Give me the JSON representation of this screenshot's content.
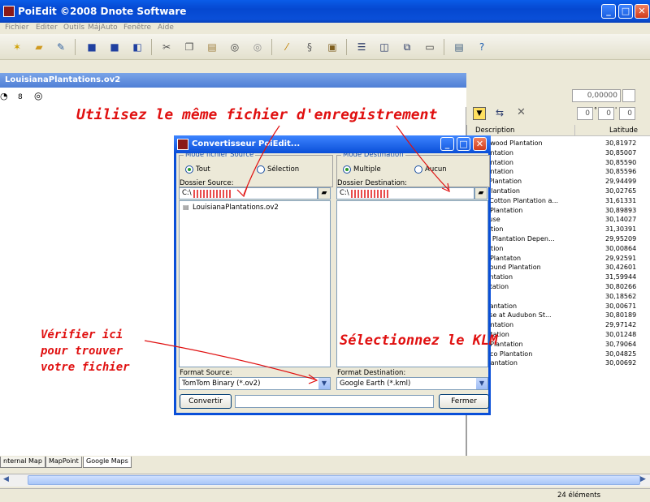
{
  "app": {
    "title": "PoiEdit ©2008 Dnote Software",
    "minimize": "_",
    "maximize": "□",
    "close": "✕"
  },
  "menu": [
    "Fichier",
    "Editer",
    "Outils",
    "MájAuto",
    "Fenêtre",
    "Aide"
  ],
  "document": {
    "tab": "LouisianaPlantations.ov2",
    "zoom_value": "8"
  },
  "right_panel": {
    "coord_field": "0,00000",
    "dms_1": "0",
    "dms_2": "0",
    "dms_3": "0",
    "col_desc": "Description",
    "col_lat": "Latitude",
    "rows": [
      {
        "d": "Greenwood Plantation",
        "l": "30,81972"
      },
      {
        "d": "ge Plantation",
        "l": "30,85007"
      },
      {
        "d": "ge Plantation",
        "l": "30,85590"
      },
      {
        "d": "ge Plantation",
        "l": "30,85596"
      },
      {
        "d": "phan Plantation",
        "l": "29,94499"
      },
      {
        "d": "reen Plantation",
        "l": "30,02765"
      },
      {
        "d": "more Cotton Plantation a...",
        "l": "31,61331"
      },
      {
        "d": "wood Plantation",
        "l": "30,89893"
      },
      {
        "d": "as House",
        "l": "30,14027"
      },
      {
        "d": "Plantation",
        "l": "31,30391"
      },
      {
        "d": "anche Plantation Depen...",
        "l": "29,95209"
      },
      {
        "d": "Plantation",
        "l": "30,00864"
      },
      {
        "d": "wood Plantaton",
        "l": "29,92591"
      },
      {
        "d": "olia Mound Plantation",
        "l": "30,42601"
      },
      {
        "d": "se Plantation",
        "l": "31,59944"
      },
      {
        "d": "s Plantation",
        "l": "30,80266"
      },
      {
        "d": "way",
        "l": "30,18562"
      },
      {
        "d": "lley Plantation",
        "l": "30,00671"
      },
      {
        "d": "y House at Audubon St...",
        "l": "30,80189"
      },
      {
        "d": "nd Plantation",
        "l": "29,97142"
      },
      {
        "d": "e Plantation",
        "l": "30,01248"
      },
      {
        "d": "down Plantation",
        "l": "30,79064"
      },
      {
        "d": "rancisco Plantation",
        "l": "30,04825"
      },
      {
        "d": "eph Plantation",
        "l": "30,00692"
      }
    ]
  },
  "map_tabs": [
    "nternal Map",
    "MapPoint",
    "Google Maps"
  ],
  "status": {
    "count": "24 éléments"
  },
  "dialog": {
    "title": "Convertisseur PoiEdit...",
    "source_mode_legend": "Mode fichier Source",
    "source_all": "Tout",
    "source_selection": "Sélection",
    "source_folder_label": "Dossier Source:",
    "source_folder_value": "C:\\",
    "source_file": "LouisianaPlantations.ov2",
    "source_format_label": "Format Source:",
    "source_format_value": "TomTom Binary (*.ov2)",
    "dest_mode_legend": "Mode Destination",
    "dest_multiple": "Multiple",
    "dest_unique": "Aucun",
    "dest_folder_label": "Dossier Destination:",
    "dest_folder_value": "C:\\",
    "dest_format_label": "Format Destination:",
    "dest_format_value": "Google Earth (*.kml)",
    "convert_button": "Convertir",
    "close_button": "Fermer"
  },
  "annotations": {
    "top": "Utilisez le même fichier d'enregistrement",
    "left_1": "Vérifier ici",
    "left_2": "pour trouver",
    "left_3": "votre fichier",
    "right": "Sélectionnez le KLM"
  },
  "colors": {
    "annotation": "#e01010",
    "title_blue": "#0a4fd8"
  }
}
